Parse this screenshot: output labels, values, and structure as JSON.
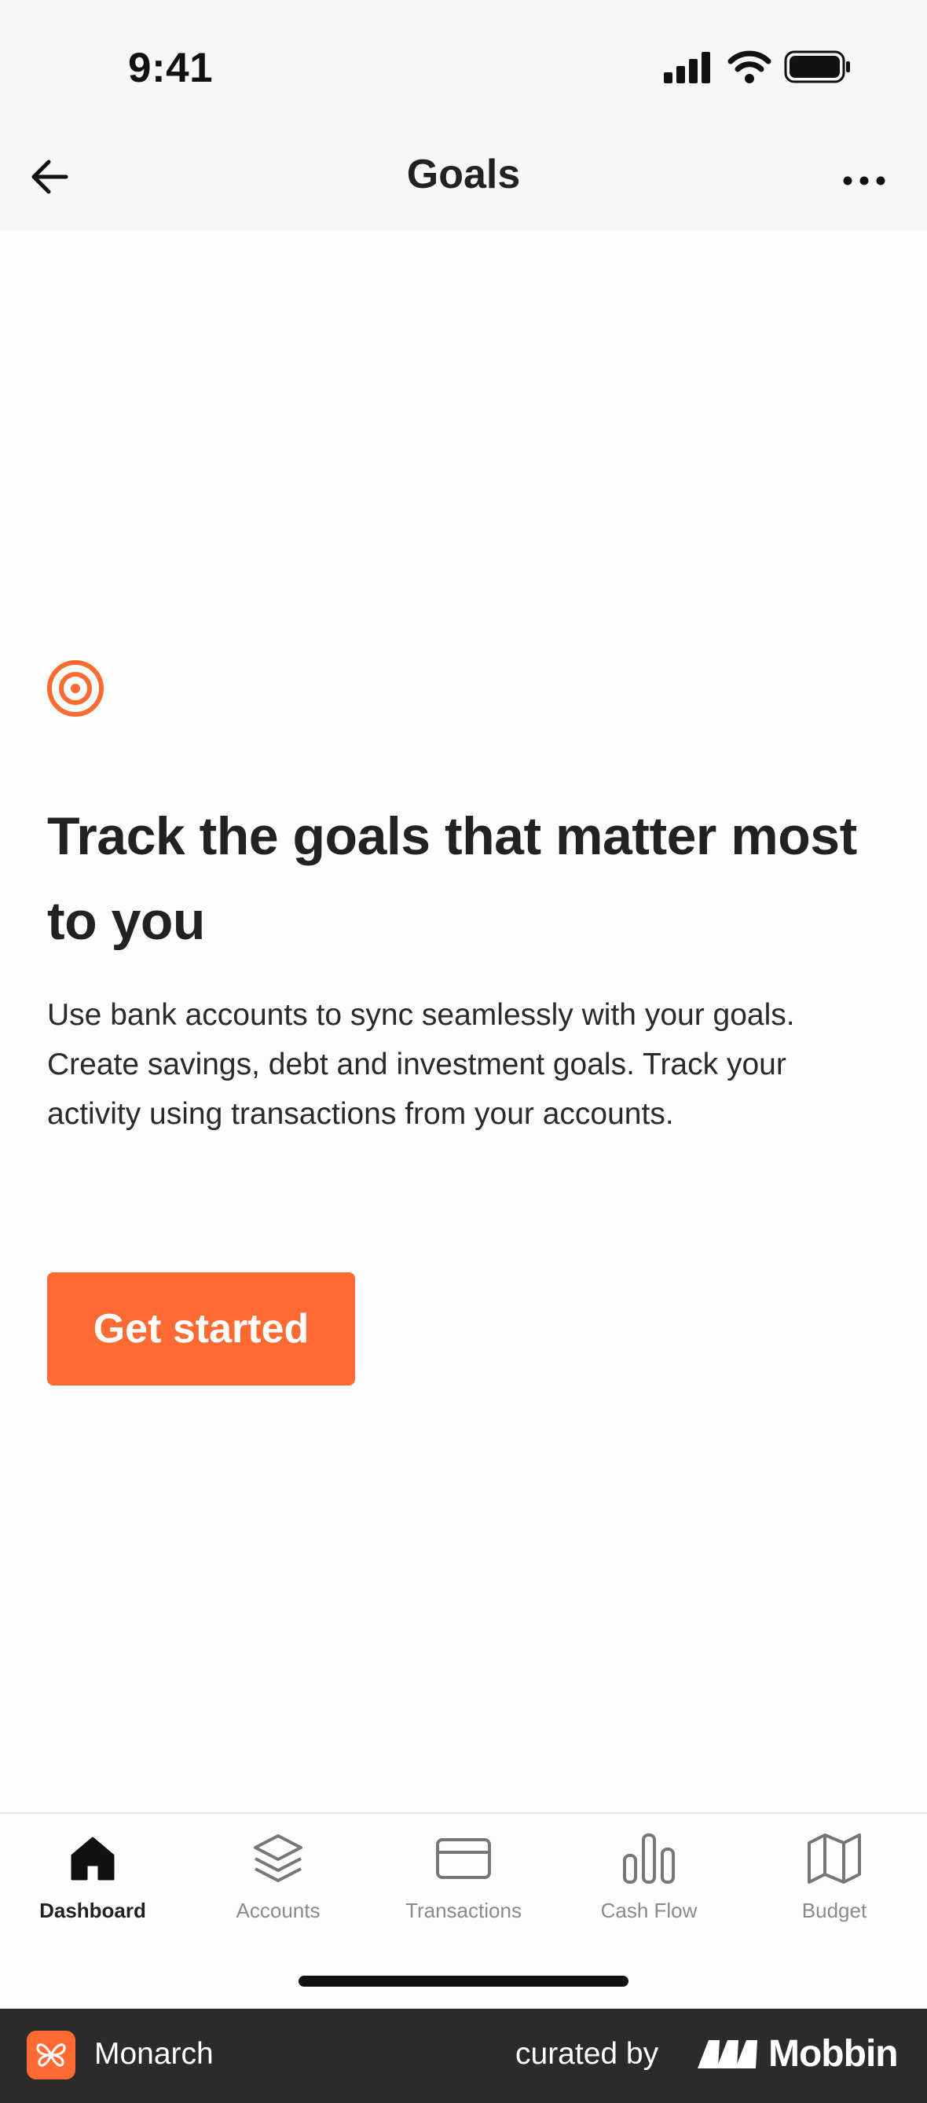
{
  "status_bar": {
    "time": "9:41"
  },
  "nav": {
    "title": "Goals"
  },
  "content": {
    "headline": "Track the goals that matter most to you",
    "body": "Use bank accounts to sync seamlessly with your goals. Create savings, debt and investment goals. Track your activity using transactions from your accounts.",
    "cta_label": "Get started",
    "icon": "target-icon",
    "accent_color": "#ff6a33"
  },
  "tabs": [
    {
      "label": "Dashboard",
      "icon": "home-icon",
      "active": true
    },
    {
      "label": "Accounts",
      "icon": "layers-icon",
      "active": false
    },
    {
      "label": "Transactions",
      "icon": "credit-card-icon",
      "active": false
    },
    {
      "label": "Cash Flow",
      "icon": "bar-chart-icon",
      "active": false
    },
    {
      "label": "Budget",
      "icon": "map-icon",
      "active": false
    }
  ],
  "footer": {
    "app_name": "Monarch",
    "curated_by": "curated by",
    "brand": "Mobbin"
  }
}
